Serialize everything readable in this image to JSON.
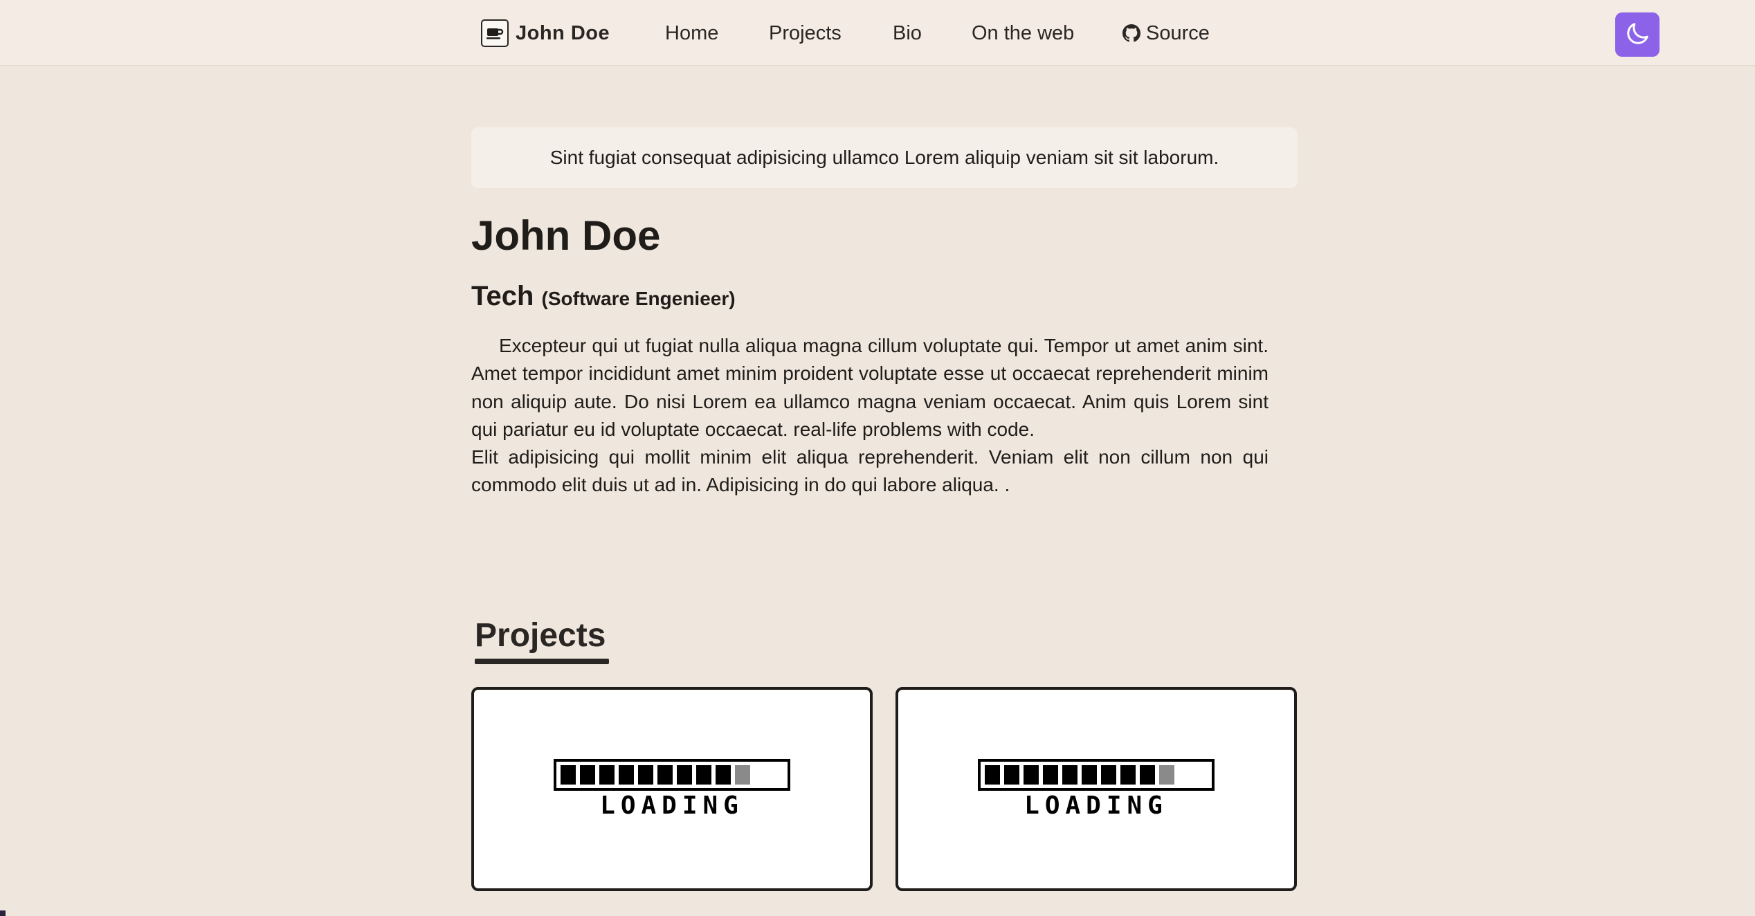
{
  "nav": {
    "brand": "John Doe",
    "brand_icon": "coffee-cup-icon",
    "links": {
      "home": "Home",
      "projects": "Projects",
      "bio": "Bio",
      "on_the_web": "On the web",
      "source": "Source"
    },
    "source_icon": "github-icon",
    "theme_toggle_icon": "moon-icon",
    "accent_color": "#8b62e8"
  },
  "banner": {
    "text": "Sint fugiat consequat adipisicing ullamco Lorem aliquip veniam sit sit laborum."
  },
  "profile": {
    "name": "John Doe",
    "field": "Tech",
    "role": "(Software Engenieer)",
    "bio_paragraph_1": "Excepteur qui ut fugiat nulla aliqua magna cillum voluptate qui. Tempor ut amet anim sint. Amet tempor incididunt amet minim proident voluptate esse ut occaecat reprehenderit minim non aliquip aute. Do nisi Lorem ea ullamco magna veniam occaecat. Anim quis Lorem sint qui pariatur eu id voluptate occaecat. real-life problems with code.",
    "bio_paragraph_2": "Elit adipisicing qui mollit minim elit aliqua reprehenderit. Veniam elit non cillum non qui commodo elit duis ut ad in. Adipisicing in do qui labore aliqua. ."
  },
  "projects": {
    "title": "Projects",
    "cards": [
      {
        "loading_label": "LOADING",
        "progress": 0.9
      },
      {
        "loading_label": "LOADING",
        "progress": 0.9
      }
    ]
  },
  "colors": {
    "background": "#efe7dd",
    "nav_background": "#f4ece4",
    "text": "#1f1c19"
  }
}
